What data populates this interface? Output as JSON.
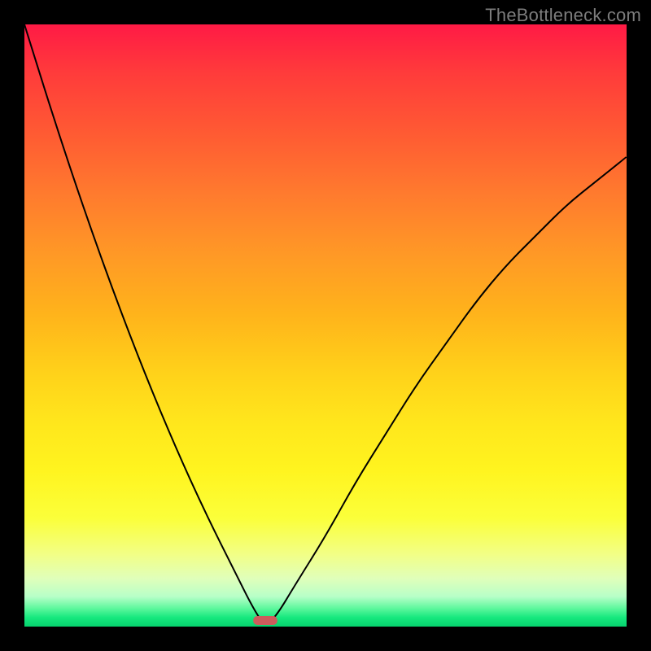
{
  "watermark": "TheBottleneck.com",
  "colors": {
    "background": "#000000",
    "gradient_top": "#ff1a45",
    "gradient_bottom": "#06d26e",
    "curve": "#000000",
    "marker": "#cd5c5c"
  },
  "chart_data": {
    "type": "line",
    "title": "",
    "xlabel": "",
    "ylabel": "",
    "xlim": [
      0,
      100
    ],
    "ylim": [
      0,
      100
    ],
    "x": [
      0,
      5,
      10,
      15,
      20,
      25,
      30,
      35,
      38,
      40,
      42,
      45,
      50,
      55,
      60,
      65,
      70,
      75,
      80,
      85,
      90,
      95,
      100
    ],
    "values": [
      100,
      84,
      69,
      55,
      42,
      30,
      19,
      9,
      3,
      0,
      2,
      7,
      15,
      24,
      32,
      40,
      47,
      54,
      60,
      65,
      70,
      74,
      78
    ],
    "marker": {
      "x_center": 40,
      "width": 4,
      "y": 0
    },
    "grid": false,
    "legend": false
  }
}
